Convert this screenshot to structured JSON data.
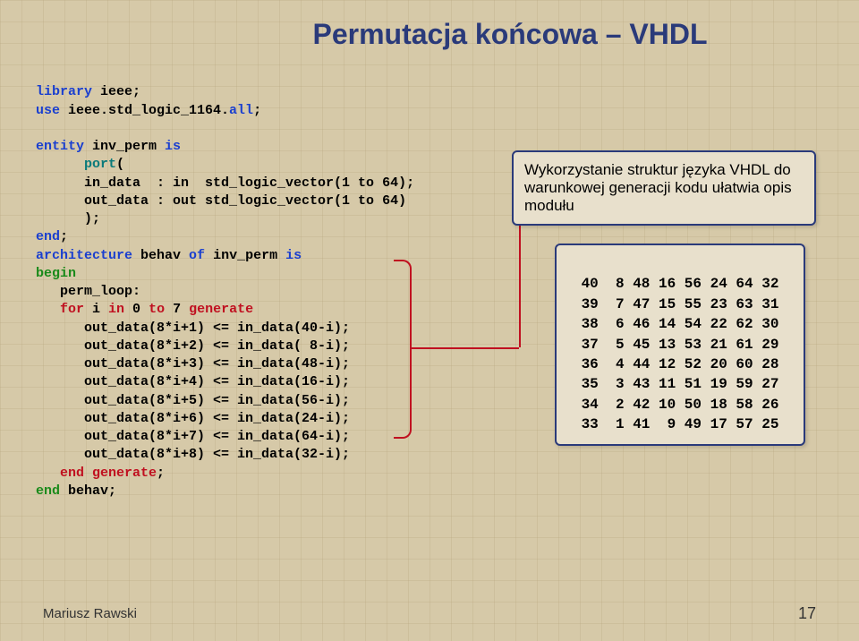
{
  "title": "Permutacja końcowa – VHDL",
  "code": {
    "l1a": "library",
    "l1b": " ieee;",
    "l2a": "use",
    "l2b": " ieee.std_logic_1164.",
    "l2c": "all",
    "l2d": ";",
    "l3a": "entity",
    "l3b": " inv_perm ",
    "l3c": "is",
    "l4a": "      port",
    "l4b": "(",
    "l5": "      in_data  : in  std_logic_vector(1 to 64);",
    "l6": "      out_data : out std_logic_vector(1 to 64)",
    "l7": "      );",
    "l8a": "end",
    "l8b": ";",
    "l9a": "architecture",
    "l9b": " behav ",
    "l9c": "of",
    "l9d": " inv_perm ",
    "l9e": "is",
    "l10": "begin",
    "l11": "   perm_loop:",
    "l12a": "   for",
    "l12b": " i ",
    "l12c": "in",
    "l12d": " 0 ",
    "l12e": "to",
    "l12f": " 7 ",
    "l12g": "generate",
    "l13": "      out_data(8*i+1) <= in_data(40-i);",
    "l14": "      out_data(8*i+2) <= in_data( 8-i);",
    "l15": "      out_data(8*i+3) <= in_data(48-i);",
    "l16": "      out_data(8*i+4) <= in_data(16-i);",
    "l17": "      out_data(8*i+5) <= in_data(56-i);",
    "l18": "      out_data(8*i+6) <= in_data(24-i);",
    "l19": "      out_data(8*i+7) <= in_data(64-i);",
    "l20": "      out_data(8*i+8) <= in_data(32-i);",
    "l21a": "   end",
    "l21b": " ",
    "l21c": "generate",
    "l21d": ";",
    "l22a": "end",
    "l22b": " behav;"
  },
  "callout": "Wykorzystanie struktur języka VHDL do warunkowej generacji kodu ułatwia opis modułu",
  "table": {
    "r1": "40  8 48 16 56 24 64 32",
    "r2": "39  7 47 15 55 23 63 31",
    "r3": "38  6 46 14 54 22 62 30",
    "r4": "37  5 45 13 53 21 61 29",
    "r5": "36  4 44 12 52 20 60 28",
    "r6": "35  3 43 11 51 19 59 27",
    "r7": "34  2 42 10 50 18 58 26",
    "r8": "33  1 41  9 49 17 57 25"
  },
  "footer": {
    "author": "Mariusz Rawski",
    "page": "17"
  }
}
